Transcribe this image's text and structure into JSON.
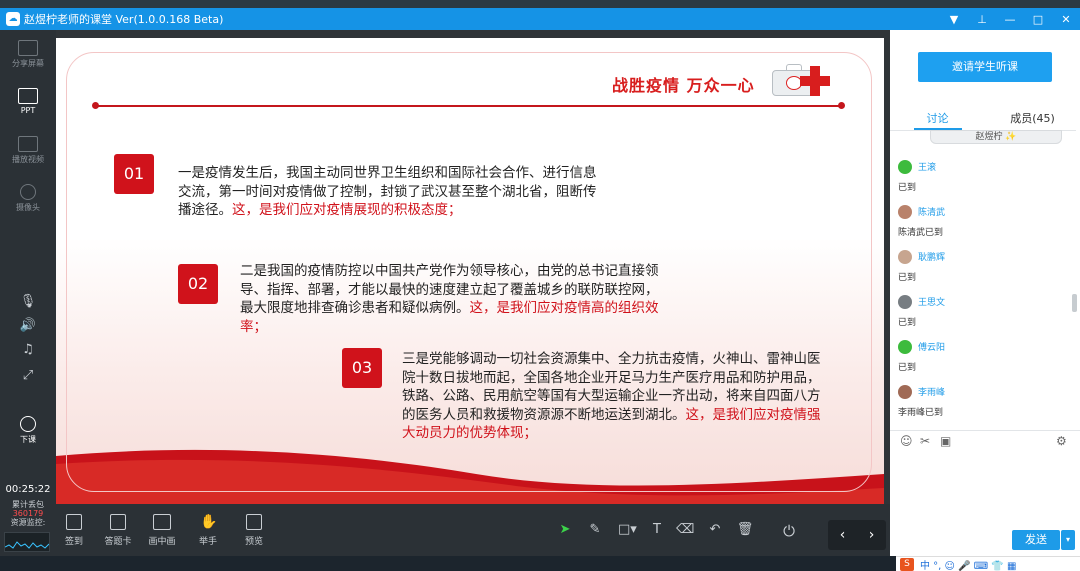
{
  "window": {
    "title": "赵煜柠老师的课堂 Ver(1.0.0.168 Beta)",
    "controls": [
      "▼",
      "⊥",
      "—",
      "□",
      "✕"
    ]
  },
  "sidebar": {
    "items": [
      {
        "label": "分享屏幕",
        "active": false
      },
      {
        "label": "PPT",
        "active": true
      },
      {
        "label": "播放视频",
        "active": false
      },
      {
        "label": "摄像头",
        "active": false
      }
    ],
    "end_class": "下课",
    "timer": "00:25:22",
    "stat_label1": "累计丢包",
    "stat_value1": "360179",
    "stat_label2": "资源监控:"
  },
  "slide": {
    "title": "战胜疫情  万众一心",
    "points": [
      {
        "num": "01",
        "text": "一是疫情发生后，我国主动同世界卫生组织和国际社会合作、进行信息交流，第一时间对疫情做了控制，封锁了武汉甚至整个湖北省，阻断传播途径。",
        "highlight": "这，是我们应对疫情展现的积极态度；"
      },
      {
        "num": "02",
        "text": "二是我国的疫情防控以中国共产党作为领导核心，由党的总书记直接领导、指挥、部署，才能以最快的速度建立起了覆盖城乡的联防联控网，最大限度地排查确诊患者和疑似病例。",
        "highlight": "这，是我们应对疫情高的组织效率；"
      },
      {
        "num": "03",
        "text": "三是党能够调动一切社会资源集中、全力抗击疫情，火神山、雷神山医院十数日拔地而起，全国各地企业开足马力生产医疗用品和防护用品，铁路、公路、民用航空等国有大型运输企业一齐出动，将来自四面八方的医务人员和救援物资源源不断地运送到湖北。",
        "highlight": "这，是我们应对疫情强大动员力的优势体现；"
      }
    ]
  },
  "toolbar": {
    "items": [
      "签到",
      "答题卡",
      "画中画",
      "举手",
      "预览"
    ],
    "prev": "‹",
    "next": "›"
  },
  "right_panel": {
    "invite_button": "邀请学生听课",
    "tab_discussion": "讨论",
    "tab_members": "成员(45)",
    "top_bubble": "赵煜柠 ✨",
    "messages": [
      {
        "name": "王滚",
        "text": "已到",
        "color": "#3dbb3d"
      },
      {
        "name": "陈清武",
        "text": "陈清武已到",
        "color": "#b9826b"
      },
      {
        "name": "耿鹏辉",
        "text": "已到",
        "color": "#c7a58f"
      },
      {
        "name": "王思文",
        "text": "已到",
        "color": "#777d82"
      },
      {
        "name": "傅云阳",
        "text": "已到",
        "color": "#3dbb3d"
      },
      {
        "name": "李雨峰",
        "text": "李雨峰已到",
        "color": "#a06a56"
      }
    ],
    "send_button": "发送",
    "send_more": "▾"
  },
  "ime": {
    "logo": "S",
    "text": "中 °, ☺ 🎤 ⌨ 👕 ▦"
  }
}
